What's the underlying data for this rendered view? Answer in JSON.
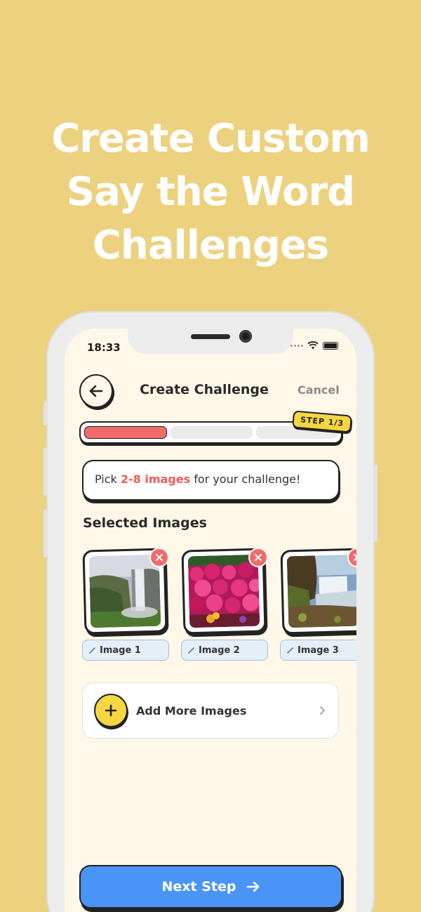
{
  "headline": [
    "Create Custom",
    "Say the Word",
    "Challenges"
  ],
  "status": {
    "time": "18:33"
  },
  "header": {
    "title": "Create Challenge",
    "cancel_label": "Cancel"
  },
  "progress": {
    "step_label": "STEP 1/3",
    "current_step": 1,
    "total_steps": 3
  },
  "instruction": {
    "prefix": "Pick ",
    "highlight": "2-8 images",
    "suffix": " for your challenge!"
  },
  "selected": {
    "title": "Selected Images",
    "items": [
      {
        "label": "Image 1",
        "scene": "waterfall-cliff"
      },
      {
        "label": "Image 2",
        "scene": "flower-field"
      },
      {
        "label": "Image 3",
        "scene": "waterfall-river"
      }
    ]
  },
  "add_more": {
    "label": "Add More Images"
  },
  "next_button": {
    "label": "Next Step"
  },
  "colors": {
    "background": "#ecd17f",
    "accent_red": "#f26a6a",
    "accent_yellow": "#f6d641",
    "primary_blue": "#4b94f7"
  }
}
